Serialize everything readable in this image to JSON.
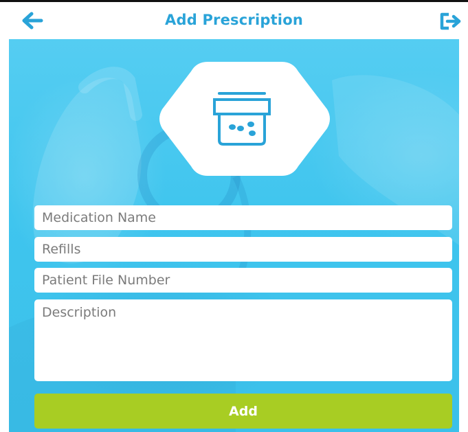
{
  "header": {
    "title": "Add Prescription",
    "back_icon": "arrow-left-icon",
    "logout_icon": "logout-icon"
  },
  "hero": {
    "icon": "medication-box-icon"
  },
  "form": {
    "medication_name_placeholder": "Medication Name",
    "refills_placeholder": "Refills",
    "patient_file_number_placeholder": "Patient File Number",
    "description_placeholder": "Description",
    "add_label": "Add"
  },
  "colors": {
    "accent": "#29a3d8",
    "background": "#45c6ef",
    "button": "#a8cd23"
  }
}
